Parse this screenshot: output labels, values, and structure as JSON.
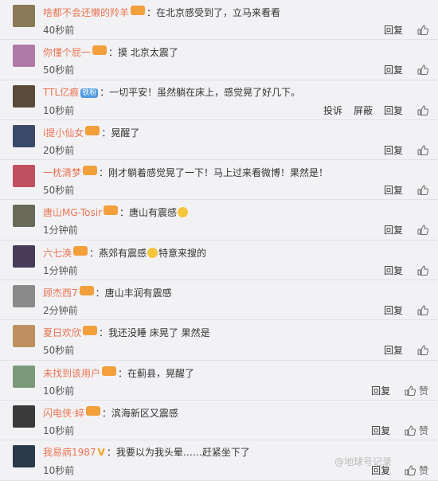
{
  "comments": [
    {
      "user": "啥都不会还懒的羚羊",
      "badge": "",
      "text": "：在北京感受到了，立马来看看",
      "emoji": false,
      "time": "40秒前",
      "actions": [
        "回复"
      ],
      "like_label": "",
      "avatar_color": "#8a7a5a"
    },
    {
      "user": "你懂个屁一",
      "badge": "",
      "text": "：摸 北京太震了",
      "emoji": false,
      "time": "50秒前",
      "actions": [
        "回复"
      ],
      "like_label": "",
      "avatar_color": "#b07aa8"
    },
    {
      "user": "TTL亿痕",
      "badge": "铁粉",
      "text": "：一切平安！虽然躺在床上，感觉晃了好几下。",
      "emoji": false,
      "time": "10秒前",
      "actions": [
        "投诉",
        "屏蔽",
        "回复"
      ],
      "like_label": "",
      "avatar_color": "#5a4a3a"
    },
    {
      "user": "i提小仙女",
      "badge": "",
      "text": "：晃醒了",
      "emoji": false,
      "time": "20秒前",
      "actions": [
        "回复"
      ],
      "like_label": "",
      "avatar_color": "#3a4a6a"
    },
    {
      "user": "一枕清梦",
      "badge": "",
      "text": "：刚才躺着感觉晃了一下！马上过来看微博！果然是！",
      "emoji": false,
      "time": "50秒前",
      "actions": [
        "回复"
      ],
      "like_label": "",
      "avatar_color": "#c05060"
    },
    {
      "user": "唐山MG-Tosir",
      "badge": "",
      "text": "：唐山有震感",
      "emoji": true,
      "time": "1分钟前",
      "actions": [
        "回复"
      ],
      "like_label": "",
      "avatar_color": "#6a6a5a"
    },
    {
      "user": "六七涣",
      "badge": "",
      "text": "：燕郊有震感",
      "emoji": true,
      "text_after": "特意来搜的",
      "time": "1分钟前",
      "actions": [
        "回复"
      ],
      "like_label": "",
      "avatar_color": "#4a3a5a"
    },
    {
      "user": "顾杰西7",
      "badge": "",
      "text": "：唐山丰润有震感",
      "emoji": false,
      "time": "2分钟前",
      "actions": [
        "回复"
      ],
      "like_label": "",
      "avatar_color": "#8a8a8a"
    },
    {
      "user": "夏日欢欣",
      "badge": "",
      "text": "：我还没睡 床晃了 果然是",
      "emoji": false,
      "time": "50秒前",
      "actions": [
        "回复"
      ],
      "like_label": "",
      "avatar_color": "#c09060"
    },
    {
      "user": "未找到该用户",
      "badge": "",
      "text": "：在蓟县，晃醒了",
      "emoji": false,
      "time": "10秒前",
      "actions": [
        "回复"
      ],
      "like_label": "赞",
      "avatar_color": "#7a9a7a"
    },
    {
      "user": "闪电侠·綷",
      "badge": "",
      "text": "：滨海新区又震感",
      "emoji": false,
      "time": "10秒前",
      "actions": [
        "回复"
      ],
      "like_label": "赞",
      "avatar_color": "#3a3a3a"
    },
    {
      "user": "我易病1987",
      "badge": "V",
      "text": "：我要以为我头晕……赶紧坐下了",
      "emoji": false,
      "time": "10秒前",
      "actions": [
        "回复"
      ],
      "like_label": "赞",
      "avatar_color": "#2a3a4a"
    }
  ],
  "watermark": "@地球号记录"
}
